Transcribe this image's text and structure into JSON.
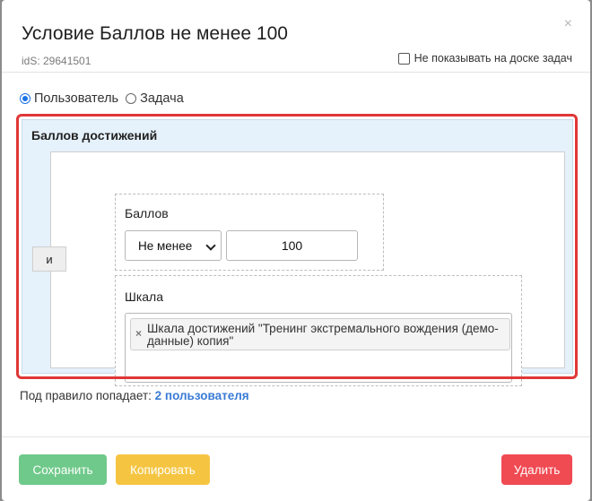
{
  "modal": {
    "title": "Условие Баллов не менее 100",
    "ids": "idS: 29641501",
    "hide_on_board_label": "Не показывать на доске задач",
    "hide_on_board_checked": false,
    "close_icon": "close-icon",
    "close_glyph": "×"
  },
  "target_type": {
    "options": [
      {
        "label": "Пользователь",
        "selected": true
      },
      {
        "label": "Задача",
        "selected": false
      }
    ]
  },
  "rule": {
    "title": "Баллов достижений",
    "operator_label": "и",
    "points_condition": {
      "label": "Баллов",
      "comparison": "Не менее",
      "value": "100"
    },
    "scale_condition": {
      "label": "Шкала",
      "remove_glyph": "×",
      "selected_scales": [
        "Шкала достижений \"Тренинг экстремального вождения (демо-данные) копия\""
      ]
    }
  },
  "summary": {
    "prefix": "Под правило попадает:",
    "link": "2 пользователя"
  },
  "footer": {
    "save_label": "Сохранить",
    "copy_label": "Копировать",
    "delete_label": "Удалить"
  },
  "colors": {
    "accent_red": "#e03737",
    "panel_blue": "#e5f1fb",
    "save_green": "#6fc98a",
    "copy_yellow": "#f5c542",
    "delete_red": "#f04a52",
    "link_blue": "#3a7bd5"
  }
}
